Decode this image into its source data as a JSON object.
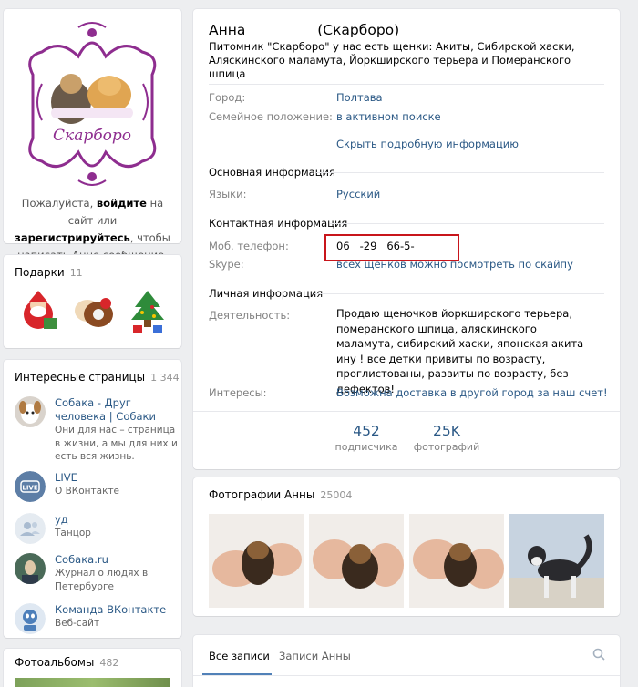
{
  "avatar": {
    "logo_text": "Скарборо",
    "prompt_prefix": "Пожалуйста, ",
    "prompt_link": "войдите",
    "prompt_middle": " на сайт или ",
    "prompt_link2": "зарегистрируйтесь",
    "prompt_suffix": ", чтобы написать Анне сообщение."
  },
  "gifts": {
    "title": "Подарки",
    "count": "11"
  },
  "pages": {
    "title": "Интересные страницы",
    "count": "1 344",
    "items": [
      {
        "name": "Собака - Друг человека | Собаки",
        "desc": "Они для нас – страница в жизни, а мы для них и есть вся жизнь."
      },
      {
        "name": "LIVE",
        "desc": "О ВКонтакте"
      },
      {
        "name": "уд",
        "desc": "Танцор"
      },
      {
        "name": "Собака.ru",
        "desc": "Журнал о людях в Петербурге"
      },
      {
        "name": "Команда ВКонтакте",
        "desc": "Веб-сайт"
      }
    ]
  },
  "albums": {
    "title": "Фотоальбомы",
    "count": "482"
  },
  "profile": {
    "name": "Анна                (Скарборо)",
    "status": "Питомник \"Скарборо\" у нас есть щенки: Акиты, Сибирской хаски, Аляскинского маламута, Йоркширского терьера и Померанского шпица",
    "city_label": "Город:",
    "city": "Полтава",
    "family_label": "Семейное положение:",
    "family": "в активном поиске",
    "hide_info": "Скрыть подробную информацию",
    "basic_header": "Основная информация",
    "lang_label": "Языки:",
    "lang": "Русский",
    "contact_header": "Контактная информация",
    "phone_label": "Моб. телефон:",
    "phone": "06   -29   66-5-",
    "skype_label": "Skype:",
    "skype": "всех щенков можно посмотреть по скайпу",
    "personal_header": "Личная информация",
    "activity_label": "Деятельность:",
    "activity": "Продаю щеночков йоркширского терьера, померанского шпица, аляскинского маламута, сибирский хаски, японская акита ину ! все детки привиты по возрасту, проглистованы, развиты по возрасту, без дефектов!",
    "interests_label": "Интересы:",
    "interests": "Возможна доставка в другой город за наш счет!"
  },
  "counters": [
    {
      "num": "452",
      "label": "подписчика"
    },
    {
      "num": "25K",
      "label": "фотографий"
    }
  ],
  "photos": {
    "title": "Фотографии Анны",
    "count": "25004"
  },
  "wall": {
    "tab_all": "Все записи",
    "tab_anna": "Записи Анны"
  },
  "colors": {
    "link": "#2a5885",
    "accent": "#5181b8",
    "highlight_box": "#c8151b",
    "logo_purple": "#8e2d8f"
  }
}
